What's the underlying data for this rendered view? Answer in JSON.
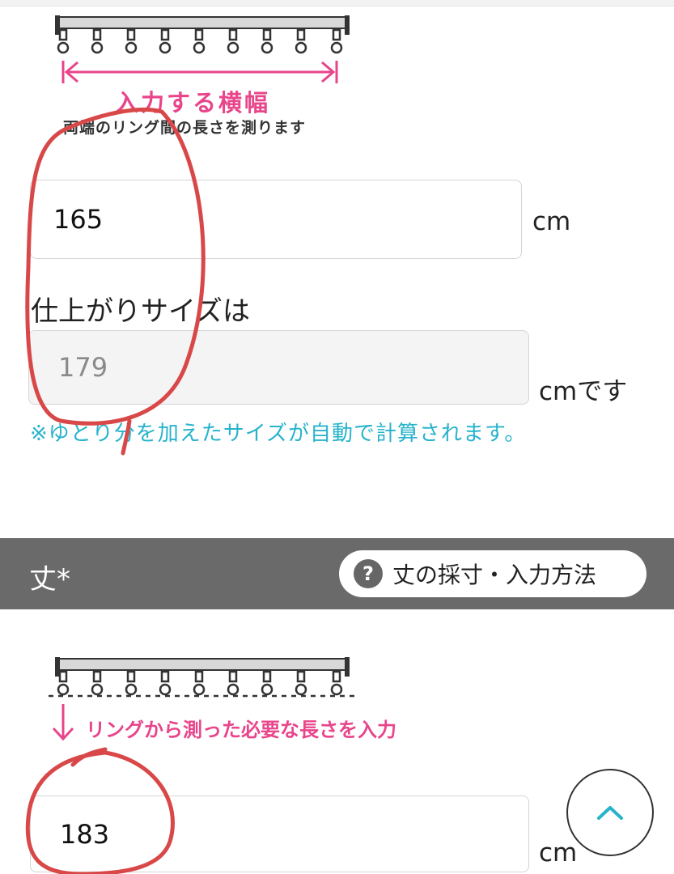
{
  "width_section": {
    "caption": "入力する横幅",
    "note": "両端のリング間の長さを測ります",
    "input_value": "165",
    "unit": "cm",
    "finish_label": "仕上がりサイズは",
    "finish_value": "179",
    "finish_unit": "cmです",
    "auto_note": "※ゆとり分を加えたサイズが自動で計算されます。"
  },
  "length_section": {
    "title": "丈*",
    "help_button_icon": "?",
    "help_button_label": "丈の採寸・入力方法",
    "caption": "リングから測った必要な長さを入力",
    "input_value": "183",
    "unit": "cm"
  },
  "scroll_top": {
    "icon": "chevron-up-icon"
  },
  "colors": {
    "accent_pink": "#e8458b",
    "note_cyan": "#27b3cc",
    "section_bar": "#6a6a6a",
    "annotation_red": "#d94848"
  }
}
